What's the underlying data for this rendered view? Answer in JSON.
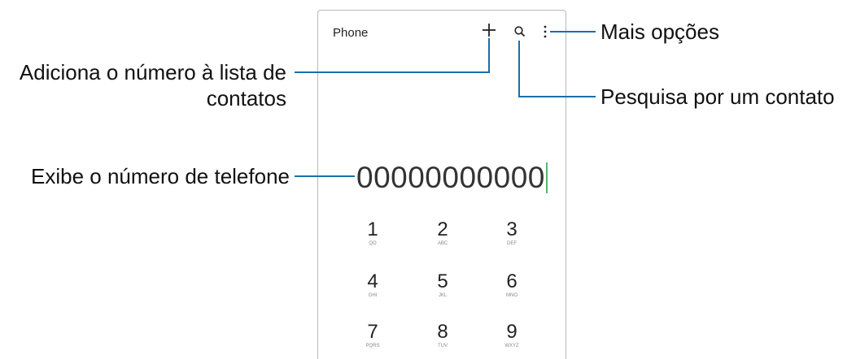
{
  "app": {
    "title": "Phone",
    "add_contact_icon": "plus-icon",
    "search_icon": "search-icon",
    "more_options_icon": "more-vertical-icon"
  },
  "dialer": {
    "number": "00000000000",
    "keys": [
      {
        "digit": "1",
        "letters": "QO"
      },
      {
        "digit": "2",
        "letters": "ABC"
      },
      {
        "digit": "3",
        "letters": "DEF"
      },
      {
        "digit": "4",
        "letters": "GHI"
      },
      {
        "digit": "5",
        "letters": "JKL"
      },
      {
        "digit": "6",
        "letters": "MNO"
      },
      {
        "digit": "7",
        "letters": "PQRS"
      },
      {
        "digit": "8",
        "letters": "TUV"
      },
      {
        "digit": "9",
        "letters": "WXYZ"
      }
    ]
  },
  "callouts": {
    "more_options": "Mais opções",
    "add_contact_line1": "Adiciona o número à lista de",
    "add_contact_line2": "contatos",
    "search_contact": "Pesquisa por um contato",
    "show_number": "Exibe o número de telefone"
  },
  "colors": {
    "callout_line": "#1a6fa8",
    "cursor": "#52b96e"
  }
}
